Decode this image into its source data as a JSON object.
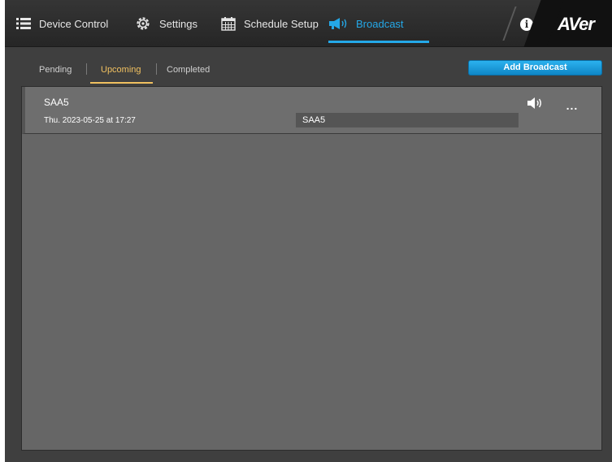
{
  "nav": {
    "device_control": "Device Control",
    "settings": "Settings",
    "schedule_setup": "Schedule Setup",
    "broadcast": "Broadcast",
    "active": "broadcast"
  },
  "brand": {
    "logo": "AVer"
  },
  "info_icon": "i",
  "tabs": {
    "pending": "Pending",
    "upcoming": "Upcoming",
    "completed": "Completed",
    "active": "upcoming"
  },
  "add_button": "Add Broadcast",
  "broadcasts": [
    {
      "title": "SAA5",
      "date": "Thu. 2023-05-25 at 17:27",
      "message": "SAA5"
    }
  ],
  "more_label": "...",
  "colors": {
    "accent_blue": "#24a8e8",
    "tab_active": "#f0c060",
    "panel": "#666666"
  }
}
